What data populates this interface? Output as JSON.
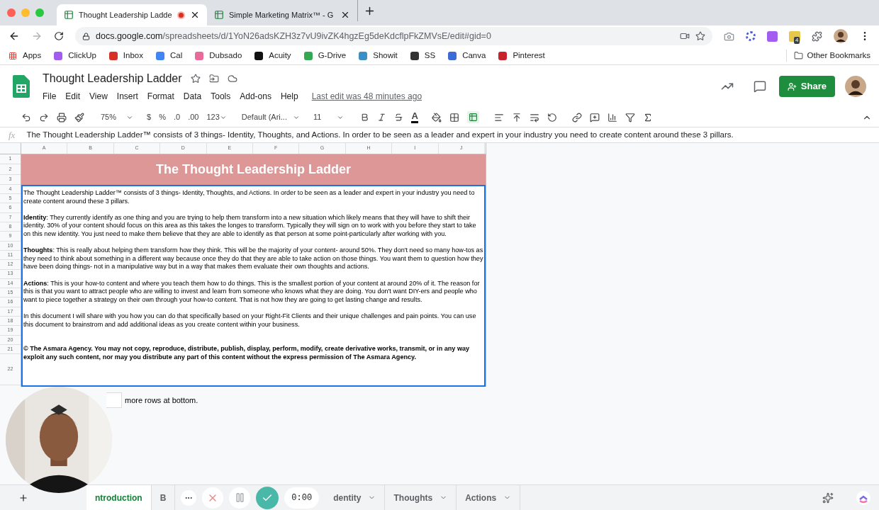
{
  "browser": {
    "tabs": [
      {
        "title": "Thought Leadership Ladde",
        "selected": true,
        "recording": true
      },
      {
        "title": "Simple Marketing Matrix™ - G",
        "selected": false,
        "recording": false
      }
    ],
    "url": {
      "host": "docs.google.com",
      "path": "/spreadsheets/d/1YoN26adsKZH3z7vU9ivZK4hgzEg5deKdcflpFkZMVsE/edit#gid=0"
    },
    "extension_badge": "4",
    "bookmarks": [
      {
        "label": "Apps",
        "kind": "apps"
      },
      {
        "label": "ClickUp",
        "kind": "site",
        "color": "#a35cf0"
      },
      {
        "label": "Inbox",
        "kind": "site",
        "color": "#d93025"
      },
      {
        "label": "Cal",
        "kind": "site",
        "color": "#4285f4"
      },
      {
        "label": "Dubsado",
        "kind": "site",
        "color": "#e96b9b"
      },
      {
        "label": "Acuity",
        "kind": "site",
        "color": "#111111"
      },
      {
        "label": "G-Drive",
        "kind": "site",
        "color": "#34a853"
      },
      {
        "label": "Showit",
        "kind": "site",
        "color": "#3b8fc4"
      },
      {
        "label": "SS",
        "kind": "site",
        "color": "#333333"
      },
      {
        "label": "Canva",
        "kind": "site",
        "color": "#3d6ad6"
      },
      {
        "label": "Pinterest",
        "kind": "site",
        "color": "#c8232c"
      }
    ],
    "other_bookmarks": "Other Bookmarks"
  },
  "doc": {
    "title": "Thought Leadership Ladder",
    "menu": [
      "File",
      "Edit",
      "View",
      "Insert",
      "Format",
      "Data",
      "Tools",
      "Add-ons",
      "Help"
    ],
    "last_edit": "Last edit was 48 minutes ago",
    "share": "Share"
  },
  "toolbar": {
    "zoom": "75%",
    "currency": "$",
    "percent": "%",
    "decimal_less": ".0",
    "decimal_more": ".00",
    "number_format": "123",
    "font": "Default (Ari...",
    "size": "11",
    "text_color": "A",
    "merge_on": true
  },
  "formula_bar": {
    "fx": "fx",
    "value": "The Thought Leadership Ladder™ consists of 3 things- Identity, Thoughts, and Actions. In order to be seen as a leader and expert in your industry you need to create content around these 3 pillars."
  },
  "sheet": {
    "columns": [
      "A",
      "B",
      "C",
      "D",
      "E",
      "F",
      "G",
      "H",
      "I",
      "J"
    ],
    "rows": [
      "1",
      "2",
      "3",
      "4",
      "5",
      "6",
      "7",
      "8",
      "9",
      "10",
      "11",
      "12",
      "13",
      "14",
      "15",
      "16",
      "17",
      "18",
      "19",
      "20",
      "21",
      "22"
    ],
    "title": "The Thought Leadership Ladder",
    "paragraphs": [
      {
        "text": "The Thought Leadership Ladder™ consists of 3 things- Identity, Thoughts, and Actions. In order to be seen as a leader and expert in your industry you need to create content around these 3 pillars.",
        "bold": false
      },
      {
        "text": "**Identity**: They currently identify as one thing and you are trying to help them transform into a new situation which likely means that they will have to shift their identity. 30% of your content should focus on this area as this takes the longes to transform. Typically they will sign on to work with you before they start to take on this new identity. You just need to make them believe that they are able to identify as that person at some point-particularly after working with you.",
        "bold": false
      },
      {
        "text": "**Thoughts**: This is really about helping them transform how they think. This will be the majority of your content- around 50%. They don't need so many how-tos as they need to think about something in a different way because once they do that they are able to take action on those things. You want them to question how they have been doing things- not in a manipulative way but in a way that makes them evaluate their own thoughts and actions.",
        "bold": false
      },
      {
        "text": "**Actions**: This is your how-to content and where you teach them how to do things. This is the smallest portion of your content at around 20% of it. The reason for this is that you want to attract people who are willing to invest and learn from someone who knows what they are doing. You don't want DIY-ers and people who want to piece together a strategy on their own through your how-to content. That is not how they are going to get lasting change and results.",
        "bold": false
      },
      {
        "text": "In this document I will share with you how you can do that specifically based on your Right-Fit Clients and their unique challenges and pain points. You can use this document to brainstrom and add additional ideas as you create content within your business.",
        "bold": false
      },
      {
        "text": "© The Asmara Agency. You may not copy, reproduce, distribute, publish, display, perform, modify, create derivative works, transmit, or in any way exploit any such content, nor may you distribute any part of this content without the express permission of The Asmara Agency.",
        "bold": true
      }
    ]
  },
  "add_rows": {
    "label": "more rows at bottom."
  },
  "recorder": {
    "timer": "0:00"
  },
  "sheet_tabs": [
    {
      "label": "ntroduction",
      "selected": true
    },
    {
      "label": "B",
      "selected": false
    },
    {
      "label": "dentity",
      "selected": false
    },
    {
      "label": "Thoughts",
      "selected": false
    },
    {
      "label": "Actions",
      "selected": false
    }
  ]
}
